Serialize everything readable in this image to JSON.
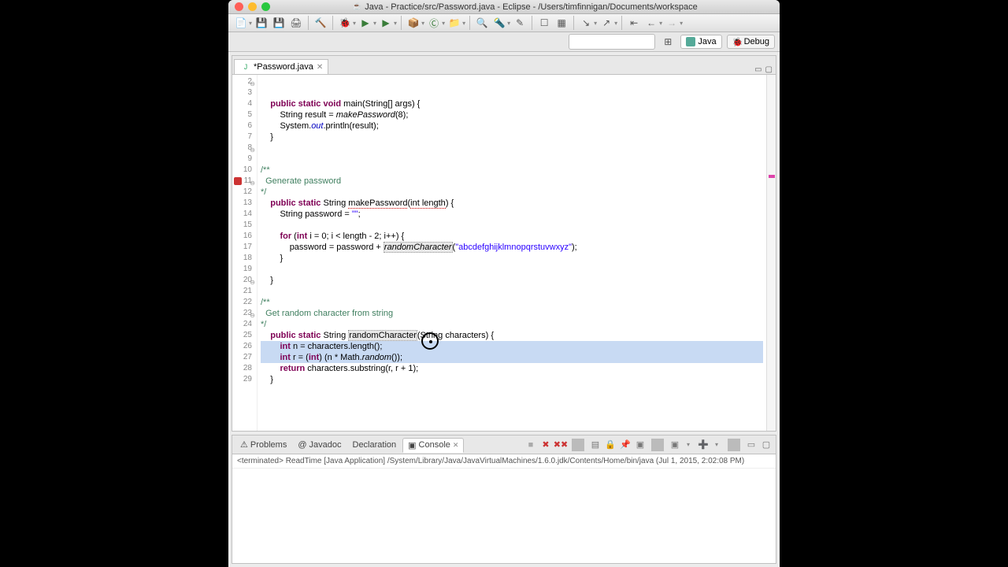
{
  "title": "Java - Practice/src/Password.java - Eclipse - /Users/timfinnigan/Documents/workspace",
  "tabs": {
    "editor": "*Password.java"
  },
  "perspectives": {
    "java": "Java",
    "debug": "Debug"
  },
  "gutter": [
    "2",
    "3",
    "4",
    "5",
    "6",
    "7",
    "8",
    "9",
    "10",
    "11",
    "12",
    "13",
    "14",
    "15",
    "16",
    "17",
    "18",
    "19",
    "20",
    "21",
    "22",
    "23",
    "24",
    "25",
    "26",
    "27",
    "28",
    "29"
  ],
  "code": {
    "selected": [
      22,
      23
    ],
    "render": [
      {
        "i": "    ",
        "t": [
          [
            "kw",
            "public static void"
          ],
          [
            "",
            " main(String[] args) {"
          ]
        ]
      },
      {
        "i": "        ",
        "t": [
          [
            "",
            "String result = "
          ],
          [
            "mth",
            "makePassword"
          ],
          [
            "",
            "(8);"
          ]
        ]
      },
      {
        "i": "        ",
        "t": [
          [
            "",
            "System."
          ],
          [
            "fld",
            "out"
          ],
          [
            "",
            ".println(result);"
          ]
        ]
      },
      {
        "i": "    ",
        "t": [
          [
            "",
            "}"
          ]
        ]
      },
      {
        "i": "",
        "t": [
          [
            "",
            ""
          ]
        ]
      },
      {
        "i": "",
        "t": [
          [
            "",
            ""
          ]
        ]
      },
      {
        "i": "",
        "t": [
          [
            "cm",
            "/**"
          ]
        ]
      },
      {
        "i": "  ",
        "t": [
          [
            "cm",
            "Generate password"
          ]
        ]
      },
      {
        "i": "",
        "t": [
          [
            "cm",
            "*/"
          ]
        ]
      },
      {
        "i": "    ",
        "t": [
          [
            "kw",
            "public static"
          ],
          [
            "",
            " String "
          ],
          [
            "err-u",
            "makePassword"
          ],
          [
            "",
            "("
          ],
          [
            "err-u",
            "int length"
          ],
          [
            "",
            ") {"
          ]
        ]
      },
      {
        "i": "        ",
        "t": [
          [
            "",
            "String password = "
          ],
          [
            "st",
            "\"\""
          ],
          [
            "",
            ";"
          ]
        ]
      },
      {
        "i": "",
        "t": [
          [
            "",
            ""
          ]
        ]
      },
      {
        "i": "        ",
        "t": [
          [
            "kw",
            "for"
          ],
          [
            "",
            " ("
          ],
          [
            "kw",
            "int"
          ],
          [
            "",
            " i = 0; i < length - 2; i++) {"
          ]
        ]
      },
      {
        "i": "            ",
        "t": [
          [
            "",
            "password = password + "
          ],
          [
            "mth box-hl",
            "randomCharacter"
          ],
          [
            "",
            "("
          ],
          [
            "st",
            "\"abcdefghijklmnopqrstuvwxyz\""
          ],
          [
            "",
            ");"
          ]
        ]
      },
      {
        "i": "        ",
        "t": [
          [
            "",
            "}"
          ]
        ]
      },
      {
        "i": "",
        "t": [
          [
            "",
            ""
          ]
        ]
      },
      {
        "i": "    ",
        "t": [
          [
            "",
            "}"
          ]
        ]
      },
      {
        "i": "",
        "t": [
          [
            "",
            ""
          ]
        ]
      },
      {
        "i": "",
        "t": [
          [
            "cm",
            "/**"
          ]
        ]
      },
      {
        "i": "  ",
        "t": [
          [
            "cm",
            "Get random character from string"
          ]
        ]
      },
      {
        "i": "",
        "t": [
          [
            "cm",
            "*/"
          ]
        ]
      },
      {
        "i": "    ",
        "t": [
          [
            "kw",
            "public static"
          ],
          [
            "",
            " String "
          ],
          [
            "box-hl",
            "randomCharacter"
          ],
          [
            "",
            "(String characters) {"
          ]
        ]
      },
      {
        "i": "        ",
        "t": [
          [
            "kw",
            "int"
          ],
          [
            "",
            " n = characters.length();"
          ]
        ]
      },
      {
        "i": "        ",
        "t": [
          [
            "kw",
            "int"
          ],
          [
            "",
            " r = ("
          ],
          [
            "kw",
            "int"
          ],
          [
            "",
            ") (n * Math."
          ],
          [
            "mth",
            "random"
          ],
          [
            "",
            "());"
          ]
        ]
      },
      {
        "i": "        ",
        "t": [
          [
            "kw",
            "return"
          ],
          [
            "",
            " characters.substring(r, r + 1);"
          ]
        ]
      },
      {
        "i": "    ",
        "t": [
          [
            "",
            "}"
          ]
        ]
      },
      {
        "i": "",
        "t": [
          [
            "",
            ""
          ]
        ]
      },
      {
        "i": "",
        "t": [
          [
            "",
            ""
          ]
        ]
      }
    ]
  },
  "bottom": {
    "tabs": {
      "problems": "Problems",
      "javadoc": "Javadoc",
      "declaration": "Declaration",
      "console": "Console"
    },
    "status": "<terminated> ReadTime [Java Application] /System/Library/Java/JavaVirtualMachines/1.6.0.jdk/Contents/Home/bin/java (Jul 1, 2015, 2:02:08 PM)"
  }
}
